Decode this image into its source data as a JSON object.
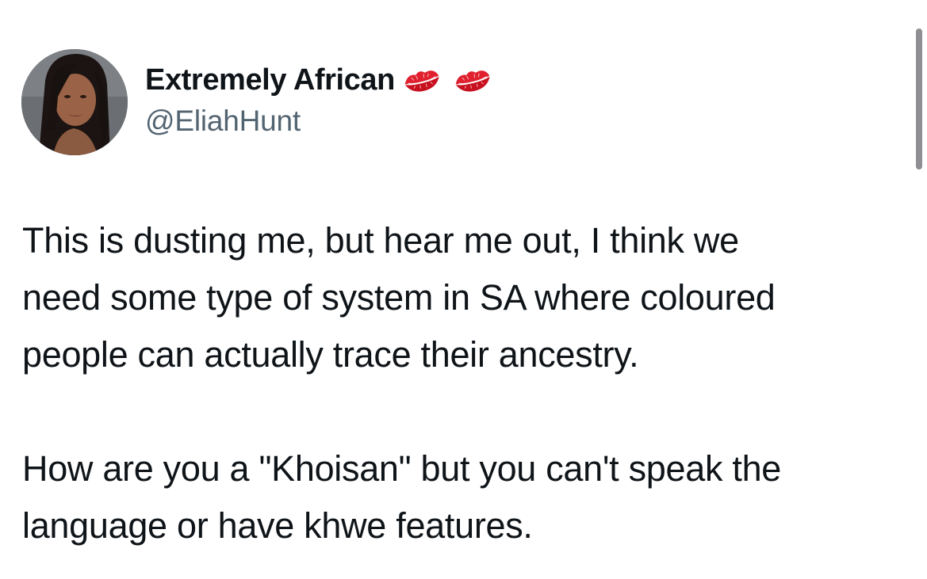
{
  "tweet": {
    "author": {
      "display_name": "Extremely African",
      "name_emojis": [
        "kiss-mark-icon",
        "kiss-mark-icon"
      ],
      "handle": "@EliahHunt"
    },
    "body": {
      "paragraph_1": "This is dusting me, but hear me out, I think we\nneed some type of system in SA where coloured\npeople can actually trace their ancestry.",
      "paragraph_2": "How are you a \"Khoisan\" but you can't speak the\nlanguage or have khwe features."
    }
  },
  "colors": {
    "text_primary": "#0f1419",
    "text_secondary": "#536471",
    "emoji_red": "#e0202e"
  }
}
